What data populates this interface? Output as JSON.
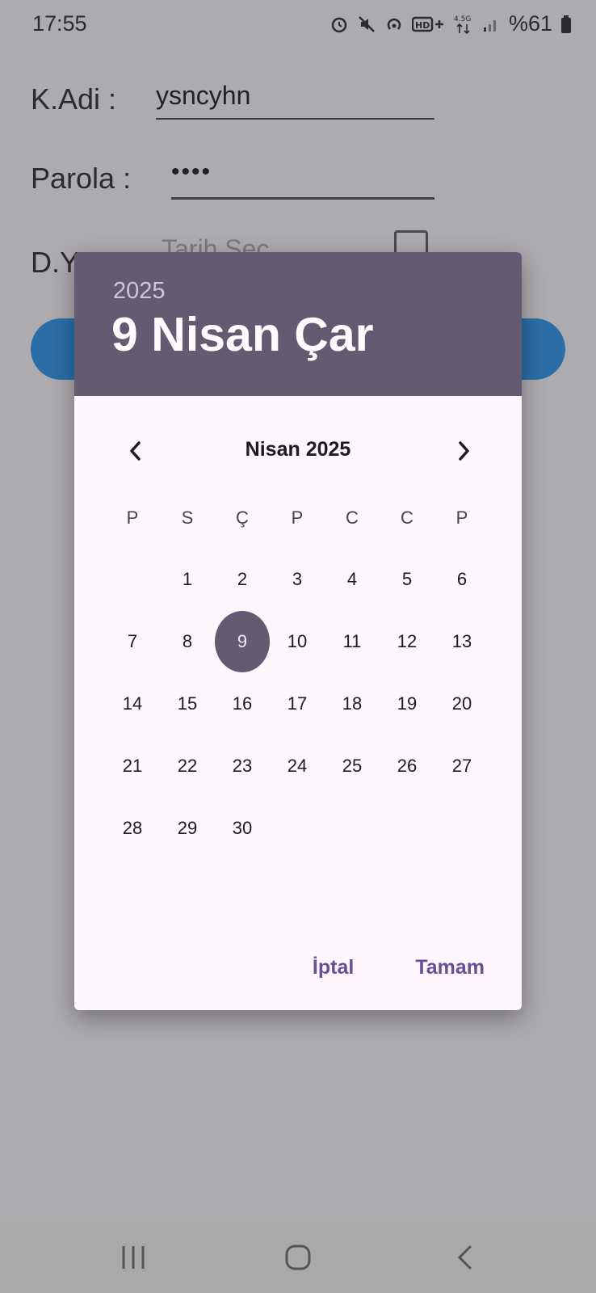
{
  "status_bar": {
    "time": "17:55",
    "icons": [
      "alarm-icon",
      "mute-icon",
      "hotspot-icon",
      "hd-plus-icon",
      "mobile-data-icon",
      "signal-icon"
    ],
    "battery": "%61"
  },
  "form": {
    "username_label": "K.Adi :",
    "username_value": "ysncyhn",
    "password_label": "Parola :",
    "password_value": "••••",
    "birthdate_label": "D.Y :",
    "birthdate_placeholder": "Tarih Seç",
    "button_color": "#2196f3"
  },
  "dialog": {
    "header_year": "2025",
    "header_date": "9 Nisan Çar",
    "month_title": "Nisan 2025",
    "weekdays": [
      "P",
      "S",
      "Ç",
      "P",
      "C",
      "C",
      "P"
    ],
    "days": [
      "",
      "1",
      "2",
      "3",
      "4",
      "5",
      "6",
      "7",
      "8",
      "9",
      "10",
      "11",
      "12",
      "13",
      "14",
      "15",
      "16",
      "17",
      "18",
      "19",
      "20",
      "21",
      "22",
      "23",
      "24",
      "25",
      "26",
      "27",
      "28",
      "29",
      "30"
    ],
    "selected_day": "9",
    "cancel_label": "İptal",
    "ok_label": "Tamam",
    "accent_color": "#625b71"
  }
}
